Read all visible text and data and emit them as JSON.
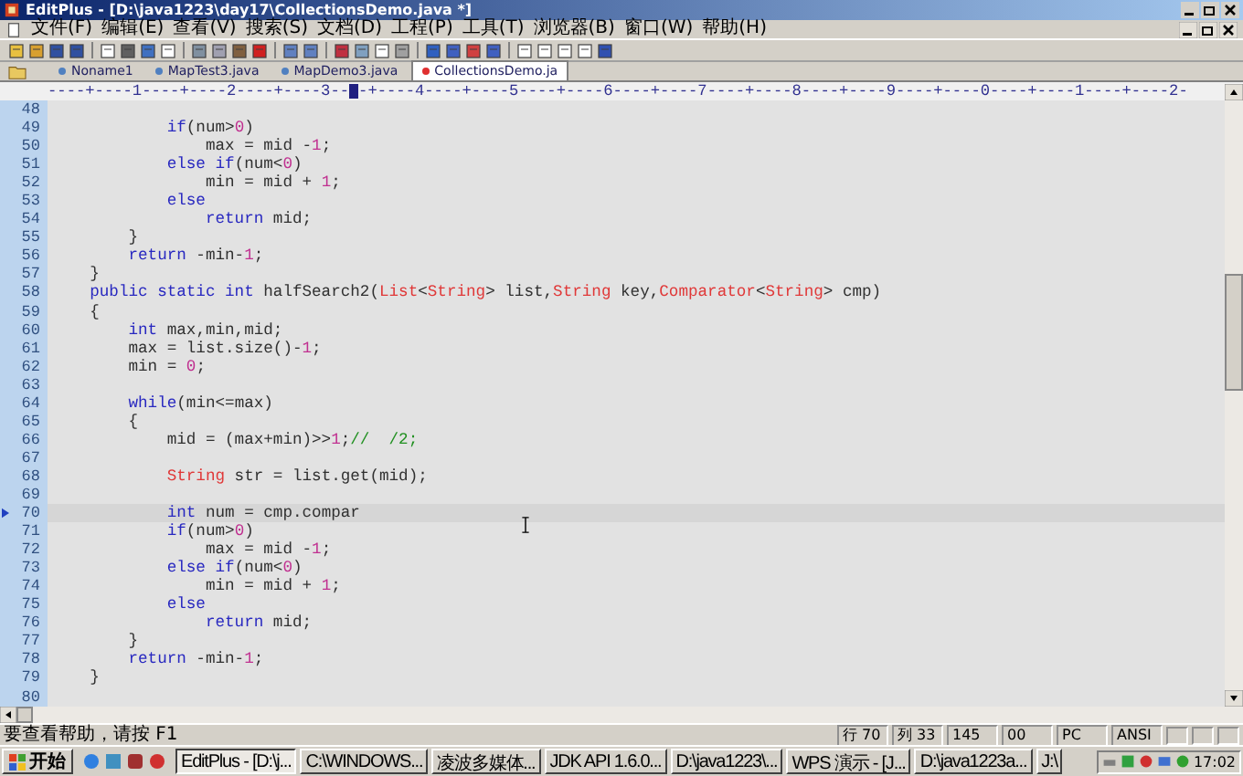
{
  "window": {
    "title": "EditPlus - [D:\\java1223\\day17\\CollectionsDemo.java *]"
  },
  "menu": [
    "文件(F)",
    "编辑(E)",
    "查看(V)",
    "搜索(S)",
    "文档(D)",
    "工程(P)",
    "工具(T)",
    "浏览器(B)",
    "窗口(W)",
    "帮助(H)"
  ],
  "tabs": [
    {
      "label": "Noname1",
      "selected": false
    },
    {
      "label": "MapTest3.java",
      "selected": false
    },
    {
      "label": "MapDemo3.java",
      "selected": false
    },
    {
      "label": "CollectionsDemo.ja",
      "selected": true
    }
  ],
  "ruler": {
    "before": "----+----1----+----2----+----3--",
    "after": "-+----4----+----5----+----6----+----7----+----8----+----9----+----0----+----1----+----2-"
  },
  "editor": {
    "lines": [
      {
        "number": "48",
        "selected": false
      },
      {
        "number": "49",
        "selected": false,
        "segments": [
          {
            "text": "            if",
            "kind": "keyword"
          },
          {
            "text": "(num>",
            "kind": "plain"
          },
          {
            "text": "0",
            "kind": "number"
          },
          {
            "text": ")",
            "kind": "plain"
          }
        ]
      },
      {
        "number": "50",
        "selected": false,
        "segments": [
          {
            "text": "                max = mid -",
            "kind": "plain"
          },
          {
            "text": "1",
            "kind": "number"
          },
          {
            "text": ";",
            "kind": "plain"
          }
        ]
      },
      {
        "number": "51",
        "selected": false,
        "segments": [
          {
            "text": "            else if",
            "kind": "keyword"
          },
          {
            "text": "(num<",
            "kind": "plain"
          },
          {
            "text": "0",
            "kind": "number"
          },
          {
            "text": ")",
            "kind": "plain"
          }
        ]
      },
      {
        "number": "52",
        "selected": false,
        "segments": [
          {
            "text": "                min = mid + ",
            "kind": "plain"
          },
          {
            "text": "1",
            "kind": "number"
          },
          {
            "text": ";",
            "kind": "plain"
          }
        ]
      },
      {
        "number": "53",
        "selected": false,
        "segments": [
          {
            "text": "            else",
            "kind": "keyword"
          }
        ]
      },
      {
        "number": "54",
        "selected": false,
        "segments": [
          {
            "text": "                return",
            "kind": "keyword"
          },
          {
            "text": " mid;",
            "kind": "plain"
          }
        ]
      },
      {
        "number": "55",
        "selected": false,
        "segments": [
          {
            "text": "        }",
            "kind": "plain"
          }
        ]
      },
      {
        "number": "56",
        "selected": false,
        "segments": [
          {
            "text": "        return",
            "kind": "keyword"
          },
          {
            "text": " -min-",
            "kind": "plain"
          },
          {
            "text": "1",
            "kind": "number"
          },
          {
            "text": ";",
            "kind": "plain"
          }
        ]
      },
      {
        "number": "57",
        "selected": false,
        "segments": [
          {
            "text": "    }",
            "kind": "plain"
          }
        ]
      },
      {
        "number": "58",
        "selected": false,
        "segments": [
          {
            "text": "    public static int",
            "kind": "keyword"
          },
          {
            "text": " halfSearch2(",
            "kind": "plain"
          },
          {
            "text": "List",
            "kind": "type"
          },
          {
            "text": "<",
            "kind": "plain"
          },
          {
            "text": "String",
            "kind": "type"
          },
          {
            "text": "> list,",
            "kind": "plain"
          },
          {
            "text": "String",
            "kind": "type"
          },
          {
            "text": " key,",
            "kind": "plain"
          },
          {
            "text": "Comparator",
            "kind": "type"
          },
          {
            "text": "<",
            "kind": "plain"
          },
          {
            "text": "String",
            "kind": "type"
          },
          {
            "text": "> cmp)",
            "kind": "plain"
          }
        ]
      },
      {
        "number": "59",
        "selected": false,
        "segments": [
          {
            "text": "    {",
            "kind": "plain"
          }
        ]
      },
      {
        "number": "60",
        "selected": false,
        "segments": [
          {
            "text": "        int",
            "kind": "keyword"
          },
          {
            "text": " max,min,mid;",
            "kind": "plain"
          }
        ]
      },
      {
        "number": "61",
        "selected": false,
        "segments": [
          {
            "text": "        max = list.size()-",
            "kind": "plain"
          },
          {
            "text": "1",
            "kind": "number"
          },
          {
            "text": ";",
            "kind": "plain"
          }
        ]
      },
      {
        "number": "62",
        "selected": false,
        "segments": [
          {
            "text": "        min = ",
            "kind": "plain"
          },
          {
            "text": "0",
            "kind": "number"
          },
          {
            "text": ";",
            "kind": "plain"
          }
        ]
      },
      {
        "number": "63",
        "selected": false
      },
      {
        "number": "64",
        "selected": false,
        "segments": [
          {
            "text": "        while",
            "kind": "keyword"
          },
          {
            "text": "(min<=max)",
            "kind": "plain"
          }
        ]
      },
      {
        "number": "65",
        "selected": false,
        "segments": [
          {
            "text": "        {",
            "kind": "plain"
          }
        ]
      },
      {
        "number": "66",
        "selected": false,
        "segments": [
          {
            "text": "            mid = (max+min)>>",
            "kind": "plain"
          },
          {
            "text": "1",
            "kind": "number"
          },
          {
            "text": ";",
            "kind": "plain"
          },
          {
            "text": "//  /2;",
            "kind": "comment"
          }
        ]
      },
      {
        "number": "67",
        "selected": false
      },
      {
        "number": "68",
        "selected": false,
        "segments": [
          {
            "text": "            String",
            "kind": "type"
          },
          {
            "text": " str = list.get(mid);",
            "kind": "plain"
          }
        ]
      },
      {
        "number": "69",
        "selected": false
      },
      {
        "number": "70",
        "selected": true,
        "segments": [
          {
            "text": "            int",
            "kind": "keyword"
          },
          {
            "text": " num = cmp.compar",
            "kind": "plain"
          }
        ]
      },
      {
        "number": "71",
        "selected": false,
        "segments": [
          {
            "text": "            if",
            "kind": "keyword"
          },
          {
            "text": "(num>",
            "kind": "plain"
          },
          {
            "text": "0",
            "kind": "number"
          },
          {
            "text": ")",
            "kind": "plain"
          }
        ]
      },
      {
        "number": "72",
        "selected": false,
        "segments": [
          {
            "text": "                max = mid -",
            "kind": "plain"
          },
          {
            "text": "1",
            "kind": "number"
          },
          {
            "text": ";",
            "kind": "plain"
          }
        ]
      },
      {
        "number": "73",
        "selected": false,
        "segments": [
          {
            "text": "            else if",
            "kind": "keyword"
          },
          {
            "text": "(num<",
            "kind": "plain"
          },
          {
            "text": "0",
            "kind": "number"
          },
          {
            "text": ")",
            "kind": "plain"
          }
        ]
      },
      {
        "number": "74",
        "selected": false,
        "segments": [
          {
            "text": "                min = mid + ",
            "kind": "plain"
          },
          {
            "text": "1",
            "kind": "number"
          },
          {
            "text": ";",
            "kind": "plain"
          }
        ]
      },
      {
        "number": "75",
        "selected": false,
        "segments": [
          {
            "text": "            else",
            "kind": "keyword"
          }
        ]
      },
      {
        "number": "76",
        "selected": false,
        "segments": [
          {
            "text": "                return",
            "kind": "keyword"
          },
          {
            "text": " mid;",
            "kind": "plain"
          }
        ]
      },
      {
        "number": "77",
        "selected": false,
        "segments": [
          {
            "text": "        }",
            "kind": "plain"
          }
        ]
      },
      {
        "number": "78",
        "selected": false,
        "segments": [
          {
            "text": "        return",
            "kind": "keyword"
          },
          {
            "text": " -min-",
            "kind": "plain"
          },
          {
            "text": "1",
            "kind": "number"
          },
          {
            "text": ";",
            "kind": "plain"
          }
        ]
      },
      {
        "number": "79",
        "selected": false,
        "segments": [
          {
            "text": "    }",
            "kind": "plain"
          }
        ]
      },
      {
        "number": "80",
        "selected": false
      }
    ]
  },
  "status_bar": {
    "message": "要查看帮助，请按 F1",
    "fields": [
      "行 70",
      "列 33",
      "145",
      "00",
      "PC",
      "ANSI"
    ]
  },
  "taskbar": {
    "start": "开始",
    "buttons": [
      {
        "label": "EditPlus - [D:\\j...",
        "selected": true
      },
      {
        "label": "C:\\WINDOWS...",
        "selected": false
      },
      {
        "label": "凌波多媒体...",
        "selected": false
      },
      {
        "label": "JDK API 1.6.0...",
        "selected": false
      },
      {
        "label": "D:\\java1223\\...",
        "selected": false
      },
      {
        "label": "WPS 演示 - [J...",
        "selected": false
      },
      {
        "label": "D:\\java1223a...",
        "selected": false
      },
      {
        "label": "J:\\",
        "selected": false
      }
    ],
    "clock": "17:02"
  }
}
